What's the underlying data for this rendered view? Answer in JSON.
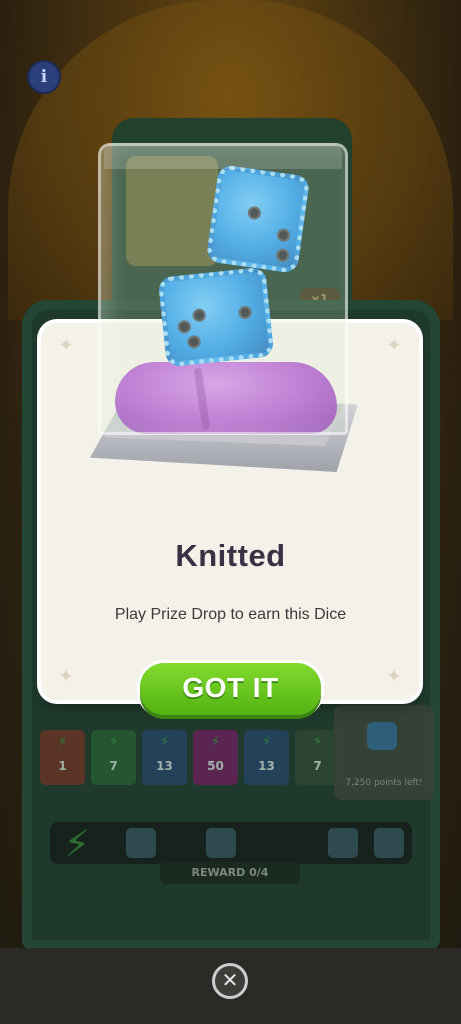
{
  "background": {
    "multiplier_badge": "x1",
    "slots": [
      {
        "value": "1",
        "color": "#5a3526"
      },
      {
        "value": "7",
        "color": "#255632"
      },
      {
        "value": "13",
        "color": "#24415a"
      },
      {
        "value": "50",
        "color": "#5b2552"
      },
      {
        "value": "13",
        "color": "#24415a"
      },
      {
        "value": "7",
        "color": "#2c4530"
      }
    ],
    "points_left": "7,250 points left!",
    "reward": "REWARD 0/4"
  },
  "popup": {
    "item_name": "Knitted",
    "description": "Play Prize Drop to earn this Dice",
    "confirm_label": "GOT IT"
  },
  "icons": {
    "info": "info-icon",
    "close": "close-icon",
    "corner": "sparkle-corner-icon",
    "bolt": "lightning-bolt-icon"
  },
  "colors": {
    "card_bg": "#f4f1e9",
    "title": "#3a3145",
    "button_green": "#6cc823",
    "dice_blue": "#2f9ef0",
    "cushion_purple": "#b65fd6"
  }
}
